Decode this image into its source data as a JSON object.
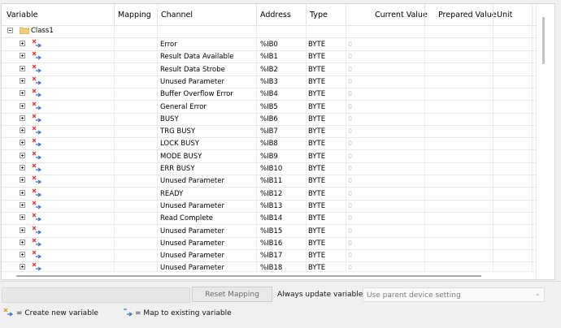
{
  "columns": {
    "variable": "Variable",
    "mapping": "Mapping",
    "channel": "Channel",
    "address": "Address",
    "type": "Type",
    "current_value": "Current Value",
    "prepared_value": "Prepared Value",
    "unit": "Unit"
  },
  "tree_root": "Class1",
  "rows": [
    {
      "channel": "Error",
      "address": "%IB0",
      "type": "BYTE",
      "current": "0"
    },
    {
      "channel": "Result Data Available",
      "address": "%IB1",
      "type": "BYTE",
      "current": "0"
    },
    {
      "channel": "Result Data Strobe",
      "address": "%IB2",
      "type": "BYTE",
      "current": "0"
    },
    {
      "channel": "Unused Parameter",
      "address": "%IB3",
      "type": "BYTE",
      "current": "0"
    },
    {
      "channel": "Buffer Overflow Error",
      "address": "%IB4",
      "type": "BYTE",
      "current": "0"
    },
    {
      "channel": "General Error",
      "address": "%IB5",
      "type": "BYTE",
      "current": "0"
    },
    {
      "channel": "BUSY",
      "address": "%IB6",
      "type": "BYTE",
      "current": "0"
    },
    {
      "channel": "TRG BUSY",
      "address": "%IB7",
      "type": "BYTE",
      "current": "0"
    },
    {
      "channel": "LOCK BUSY",
      "address": "%IB8",
      "type": "BYTE",
      "current": "0"
    },
    {
      "channel": "MODE BUSY",
      "address": "%IB9",
      "type": "BYTE",
      "current": "0"
    },
    {
      "channel": "ERR BUSY",
      "address": "%IB10",
      "type": "BYTE",
      "current": "0"
    },
    {
      "channel": "Unused Parameter",
      "address": "%IB11",
      "type": "BYTE",
      "current": "0"
    },
    {
      "channel": "READY",
      "address": "%IB12",
      "type": "BYTE",
      "current": "0"
    },
    {
      "channel": "Unused Parameter",
      "address": "%IB13",
      "type": "BYTE",
      "current": "0"
    },
    {
      "channel": "Read Complete",
      "address": "%IB14",
      "type": "BYTE",
      "current": "0"
    },
    {
      "channel": "Unused Parameter",
      "address": "%IB15",
      "type": "BYTE",
      "current": "0"
    },
    {
      "channel": "Unused Parameter",
      "address": "%IB16",
      "type": "BYTE",
      "current": "0"
    },
    {
      "channel": "Unused Parameter",
      "address": "%IB17",
      "type": "BYTE",
      "current": "0"
    },
    {
      "channel": "Unused Parameter",
      "address": "%IB18",
      "type": "BYTE",
      "current": "0"
    }
  ],
  "icons": {
    "expand": "plus-expander-icon",
    "collapse": "minus-expander-icon",
    "folder": "folder-icon",
    "variable": "io-variable-icon",
    "new_variable": "create-new-variable-icon",
    "map_existing": "map-existing-variable-icon"
  },
  "toolbar": {
    "reset_mapping": "Reset Mapping",
    "always_update": "Always update variables",
    "update_option": "Use parent device setting"
  },
  "legend": {
    "new_variable": "= Create new variable",
    "map_existing": "= Map to existing variable"
  },
  "colors": {
    "folder": "#e9c46a",
    "arrow_blue": "#3a6fc4",
    "cross_red": "#d23b3b"
  }
}
